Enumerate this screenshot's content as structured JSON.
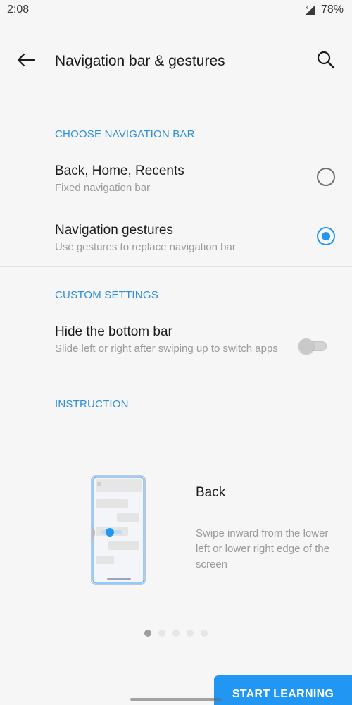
{
  "status_bar": {
    "time": "2:08",
    "battery": "78%",
    "icons": [
      "no-sim-signal-icon"
    ]
  },
  "top_bar": {
    "title": "Navigation bar & gestures",
    "back_icon": "arrow-left-icon",
    "search_icon": "search-icon"
  },
  "sections": {
    "choose_nav": {
      "header": "CHOOSE NAVIGATION BAR",
      "options": [
        {
          "title": "Back, Home, Recents",
          "summary": "Fixed navigation bar",
          "checked": false
        },
        {
          "title": "Navigation gestures",
          "summary": "Use gestures to replace navigation bar",
          "checked": true
        }
      ]
    },
    "custom": {
      "header": "CUSTOM SETTINGS",
      "hide_bottom_bar": {
        "title": "Hide the bottom bar",
        "summary": "Slide left or right after swiping up to switch apps",
        "enabled": false
      }
    },
    "instruction": {
      "header": "INSTRUCTION",
      "title": "Back",
      "description": "Swipe inward from the lower left or lower right edge of the screen",
      "pages_total": 5,
      "current_page": 1
    }
  },
  "start_button": {
    "label": "START LEARNING"
  },
  "colors": {
    "accent": "#2196f3",
    "section_header": "#2f8fd8",
    "background": "#f6f6f6"
  }
}
